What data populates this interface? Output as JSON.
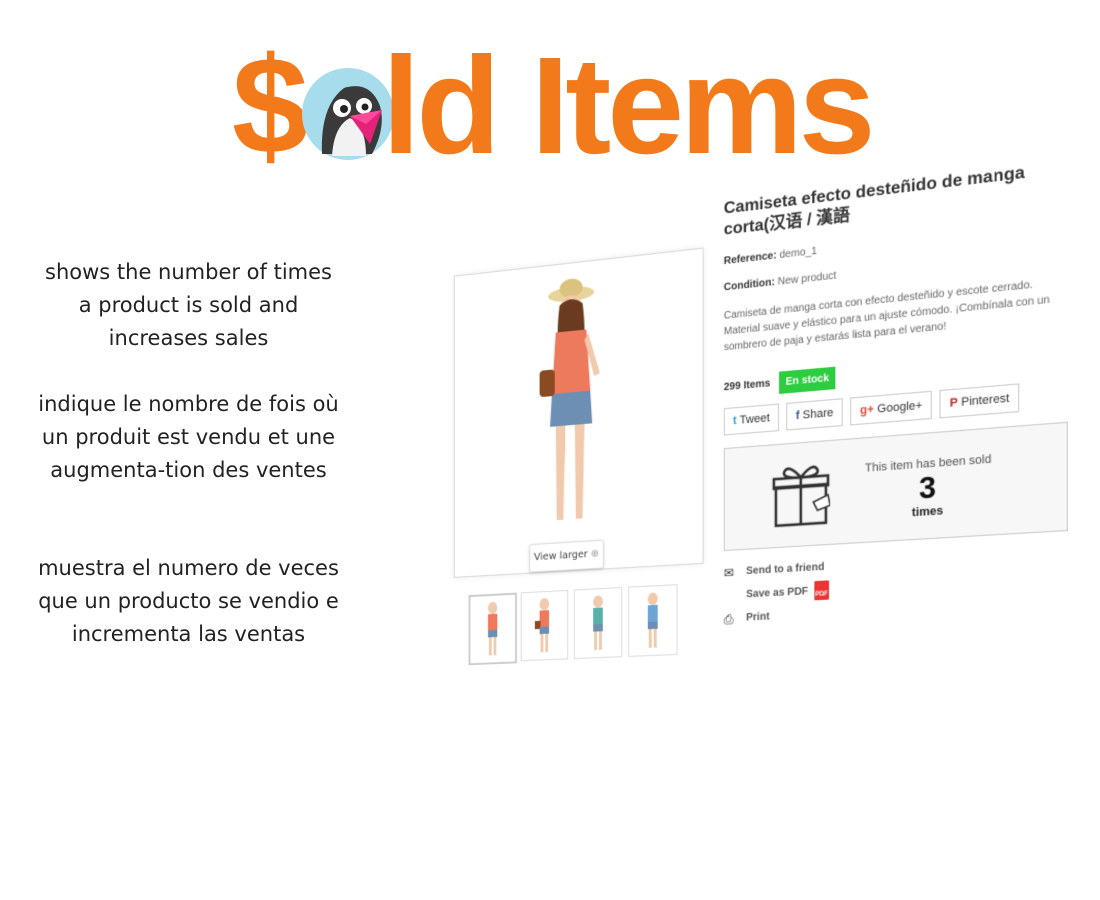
{
  "banner": {
    "dollar": "$",
    "text": "ld Items"
  },
  "blurbs": [
    "shows the number of times a product is sold and increases sales",
    "indique le nombre de fois où un produit est vendu et une augmenta-tion des ventes",
    "muestra el numero de veces que un producto se vendio e incrementa las ventas"
  ],
  "product": {
    "title": "Camiseta efecto desteñido de manga corta(汉语 / 漢語",
    "reference_label": "Reference:",
    "reference_value": "demo_1",
    "condition_label": "Condition:",
    "condition_value": "New product",
    "description": "Camiseta de manga corta con efecto desteñido y escote cerrado. Material suave y elástico para un ajuste cómodo. ¡Combínala con un sombrero de paja y estarás lista para el verano!",
    "items_count": "299 Items",
    "stock_badge": "En stock",
    "view_larger": "View larger",
    "share": {
      "tweet": "Tweet",
      "share": "Share",
      "google": "Google+",
      "pinterest": "Pinterest"
    },
    "sold": {
      "label": "This item has been sold",
      "count": "3",
      "unit": "times"
    },
    "links": {
      "send": "Send to a friend",
      "pdf": "Save as PDF",
      "pdf_icon_text": "PDF",
      "print": "Print"
    }
  },
  "colors": {
    "brand_orange": "#f27a1a",
    "stock_green": "#2ecc40"
  }
}
